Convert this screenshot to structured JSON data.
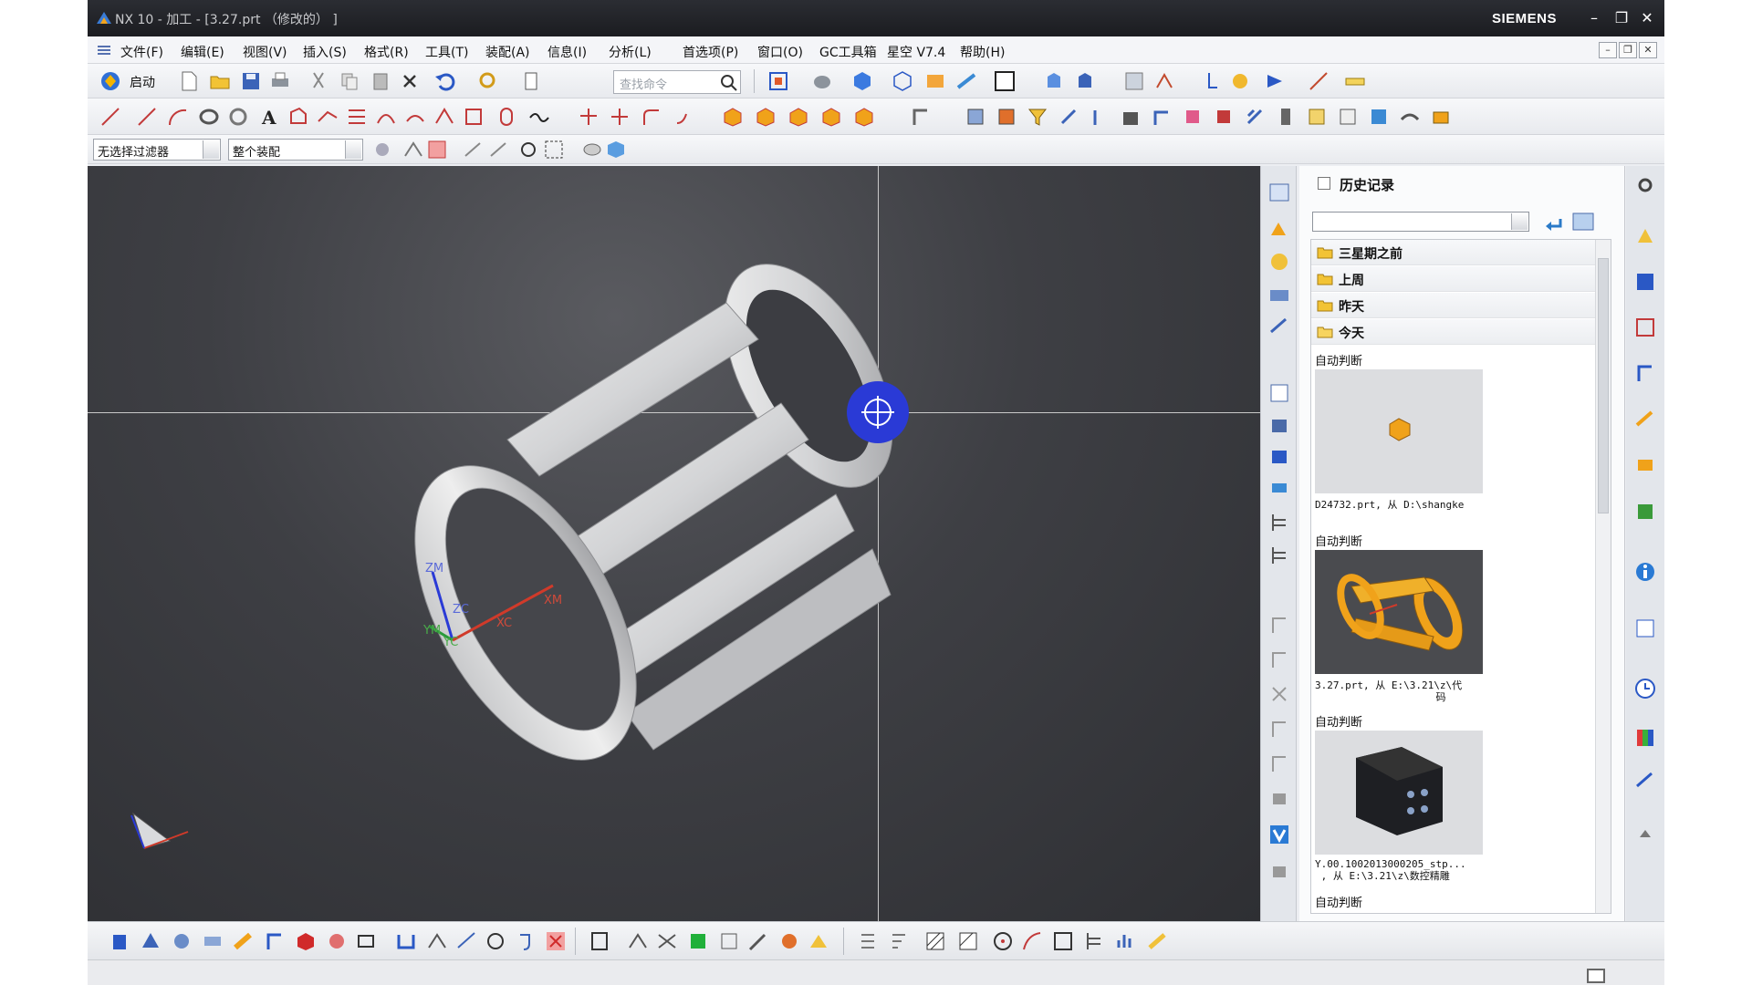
{
  "window": {
    "title": "NX 10 - 加工 - [3.27.prt （修改的） ]",
    "brand": "SIEMENS",
    "controls": [
      "–",
      "❐",
      "✕"
    ]
  },
  "menu": {
    "items": [
      "文件(F)",
      "编辑(E)",
      "视图(V)",
      "插入(S)",
      "格式(R)",
      "工具(T)",
      "装配(A)",
      "信息(I)",
      "分析(L)",
      "首选项(P)",
      "窗口(O)",
      "GC工具箱",
      "星空 V7.4",
      "帮助(H)"
    ]
  },
  "toolbar": {
    "start_label": "启动",
    "search_placeholder": "查找命令",
    "filter_value": "无选择过滤器",
    "scope_value": "整个装配"
  },
  "viewport": {
    "axis_labels": [
      "ZM",
      "ZC",
      "XM",
      "XC",
      "YM",
      "YC"
    ],
    "bg_color": "#3e3f44",
    "model_color": "#d9dadc"
  },
  "history": {
    "title": "历史记录",
    "folders": [
      "三星期之前",
      "上周",
      "昨天",
      "今天"
    ],
    "entries": [
      {
        "label": "自动判断",
        "caption": "D24732.prt, 从 D:\\shangke"
      },
      {
        "label": "自动判断",
        "caption": "3.27.prt, 从 E:\\3.21\\z\\代\n                    码"
      },
      {
        "label": "自动判断",
        "caption": "Y.00.1002013000205_stp...\n , 从 E:\\3.21\\z\\数控精雕"
      },
      {
        "label": "自动判断",
        "caption": ""
      }
    ]
  },
  "colors": {
    "accent_blue": "#2a3ad6",
    "folder_yellow": "#f2c335",
    "part_orange": "#f0a21a"
  }
}
